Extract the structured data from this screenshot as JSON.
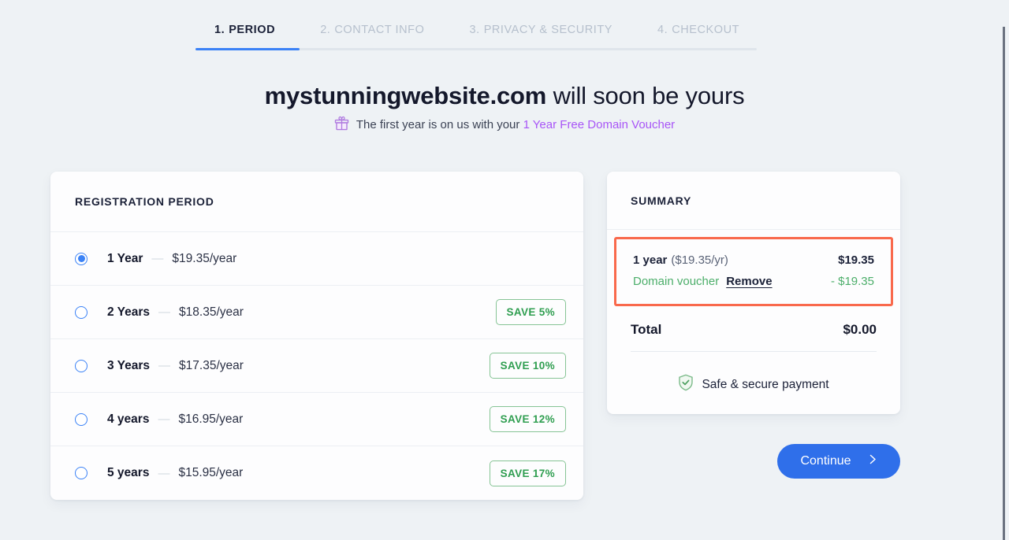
{
  "stepper": {
    "steps": [
      {
        "num": "1.",
        "label": "PERIOD",
        "active": true
      },
      {
        "num": "2.",
        "label": "CONTACT INFO",
        "active": false
      },
      {
        "num": "3.",
        "label": "PRIVACY & SECURITY",
        "active": false
      },
      {
        "num": "4.",
        "label": "CHECKOUT",
        "active": false
      }
    ],
    "progress_percent": 18.5
  },
  "headline": {
    "domain": "mystunningwebsite.com",
    "suffix": " will soon be yours"
  },
  "subline": {
    "icon": "gift-icon",
    "text": "The first year is on us with your ",
    "voucher_link": "1 Year Free Domain Voucher"
  },
  "registration": {
    "title": "REGISTRATION PERIOD",
    "options": [
      {
        "label": "1 Year",
        "dash": "—",
        "price": "$19.35/year",
        "badge": "",
        "selected": true
      },
      {
        "label": "2 Years",
        "dash": "—",
        "price": "$18.35/year",
        "badge": "SAVE 5%",
        "selected": false
      },
      {
        "label": "3 Years",
        "dash": "—",
        "price": "$17.35/year",
        "badge": "SAVE 10%",
        "selected": false
      },
      {
        "label": "4 years",
        "dash": "—",
        "price": "$16.95/year",
        "badge": "SAVE 12%",
        "selected": false
      },
      {
        "label": "5 years",
        "dash": "—",
        "price": "$15.95/year",
        "badge": "SAVE 17%",
        "selected": false
      }
    ]
  },
  "summary": {
    "title": "SUMMARY",
    "line_period_name": "1 year",
    "line_period_rate": "($19.35/yr)",
    "line_period_amount": "$19.35",
    "voucher_label": "Domain voucher",
    "voucher_remove": "Remove",
    "voucher_amount": "- $19.35",
    "total_label": "Total",
    "total_amount": "$0.00",
    "secure_text": "Safe & secure payment",
    "secure_icon": "shield-check-icon",
    "highlight_color": "#f9694c"
  },
  "continue": {
    "label": "Continue",
    "icon": "chevron-right-icon"
  },
  "colors": {
    "background": "#eef2f5",
    "accent_blue": "#2f6fea",
    "progress_blue": "#3b82f6",
    "voucher_purple": "#a855f7",
    "save_green": "#2f9e50",
    "highlight_coral": "#f9694c"
  }
}
